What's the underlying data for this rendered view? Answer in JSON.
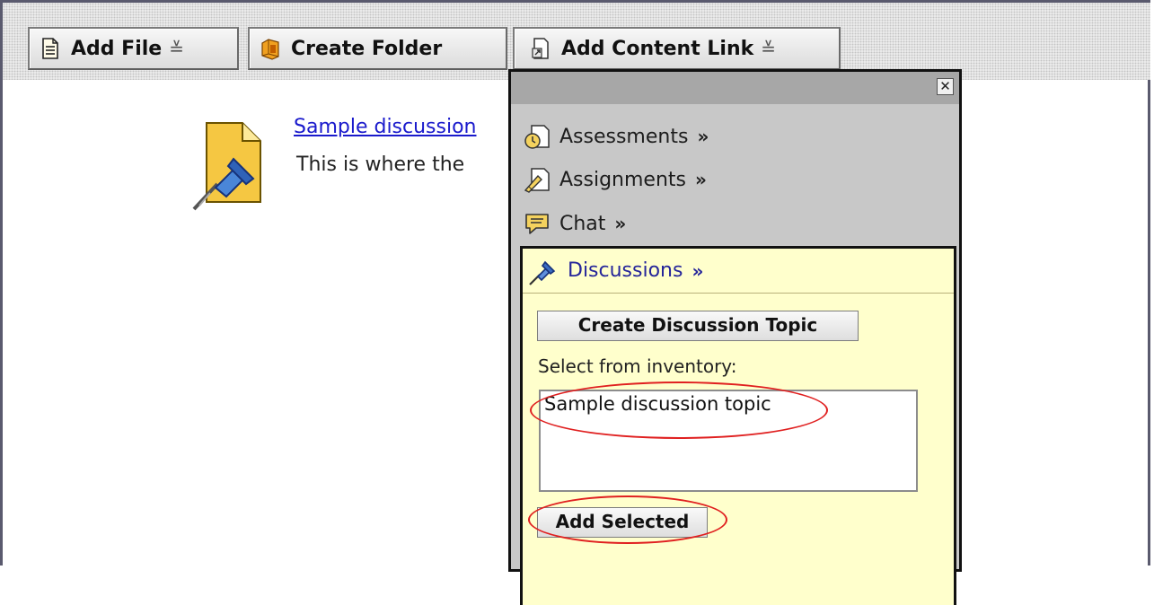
{
  "toolbar": {
    "add_file": {
      "label": "Add File",
      "icon": "document-icon",
      "caret": "≚"
    },
    "create_folder": {
      "label": "Create Folder",
      "icon": "folder-icon"
    },
    "add_content_link": {
      "label": "Add Content Link",
      "icon": "content-link-icon",
      "caret": "≚"
    }
  },
  "content": {
    "item_link": "Sample discussion",
    "item_description": "This is where the",
    "item_icon": "pushpin-document-icon"
  },
  "popup": {
    "close_glyph": "✕",
    "menu": [
      {
        "label": "Assessments",
        "icon": "assessment-icon",
        "chevron": "»"
      },
      {
        "label": "Assignments",
        "icon": "assignment-icon",
        "chevron": "»"
      },
      {
        "label": "Chat",
        "icon": "chat-bubble-icon",
        "chevron": "»"
      }
    ],
    "discussions": {
      "label": "Discussions",
      "icon": "pushpin-icon",
      "chevron": "»",
      "create_button": "Create Discussion Topic",
      "select_label": "Select from inventory:",
      "options": [
        "Sample discussion topic"
      ],
      "add_button": "Add Selected"
    }
  },
  "colors": {
    "link": "#1a1acc",
    "panel_yellow": "#ffffcc",
    "popup_gray": "#c8c8c8",
    "highlight_red": "#e02020"
  }
}
